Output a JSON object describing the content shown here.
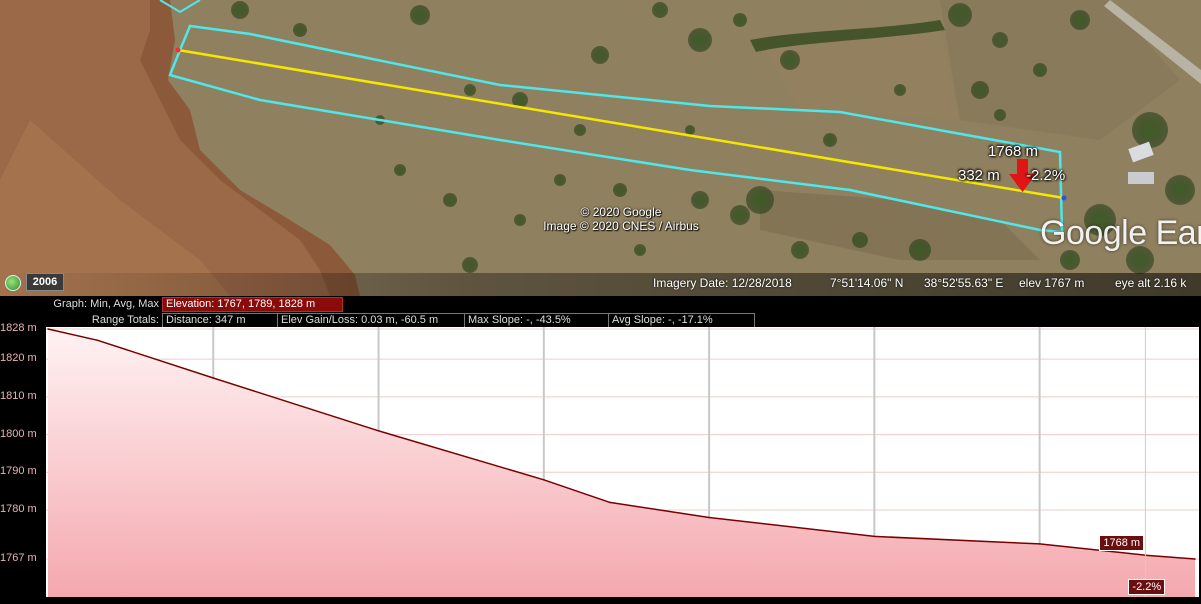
{
  "map": {
    "marker_elevation": "1768 m",
    "marker_distance": "332 m",
    "marker_slope": "-2.2%",
    "copyright_line1": "© 2020 Google",
    "copyright_line2": "Image © 2020 CNES / Airbus",
    "watermark": "Google Ear",
    "year": "2006"
  },
  "status": {
    "imagery_date": "Imagery Date: 12/28/2018",
    "latitude": "7°51'14.06\" N",
    "longitude": "38°52'55.63\" E",
    "elevation": "elev  1767 m",
    "eye_alt": "eye alt   2.16 k"
  },
  "profile": {
    "graph_label": "Graph: Min, Avg, Max",
    "elevation_stat": "Elevation: 1767, 1789, 1828 m",
    "range_label": "Range Totals:",
    "distance_stat": "Distance: 347 m",
    "gain_loss_stat": "Elev Gain/Loss: 0.03 m, -60.5 m",
    "max_slope_stat": "Max Slope: -, -43.5%",
    "avg_slope_stat": "Avg Slope: -, -17.1%",
    "y_tick_labels": [
      "1828 m",
      "1820 m",
      "1810 m",
      "1800 m",
      "1790 m",
      "1780 m",
      "1767 m"
    ],
    "callout_elevation": "1768 m",
    "callout_slope": "-2.2%"
  },
  "chart_data": {
    "type": "area",
    "x_unit": "m",
    "y_unit": "m",
    "xlim": [
      0,
      347
    ],
    "ylim": [
      1767,
      1828
    ],
    "x": [
      0,
      15,
      50,
      100,
      150,
      170,
      200,
      250,
      300,
      332,
      347
    ],
    "y": [
      1828,
      1825,
      1815,
      1801,
      1788,
      1782,
      1778,
      1773,
      1771,
      1768,
      1767
    ],
    "y_ticks": [
      1828,
      1820,
      1810,
      1800,
      1790,
      1780,
      1767
    ],
    "x_gridlines": [
      50,
      100,
      150,
      200,
      250,
      300
    ],
    "grid": true,
    "colors": {
      "line": "#7a0000",
      "fill_top": "#ffffff",
      "fill_bottom": "#f4a8ae",
      "grid": "#c8c8c8"
    }
  }
}
